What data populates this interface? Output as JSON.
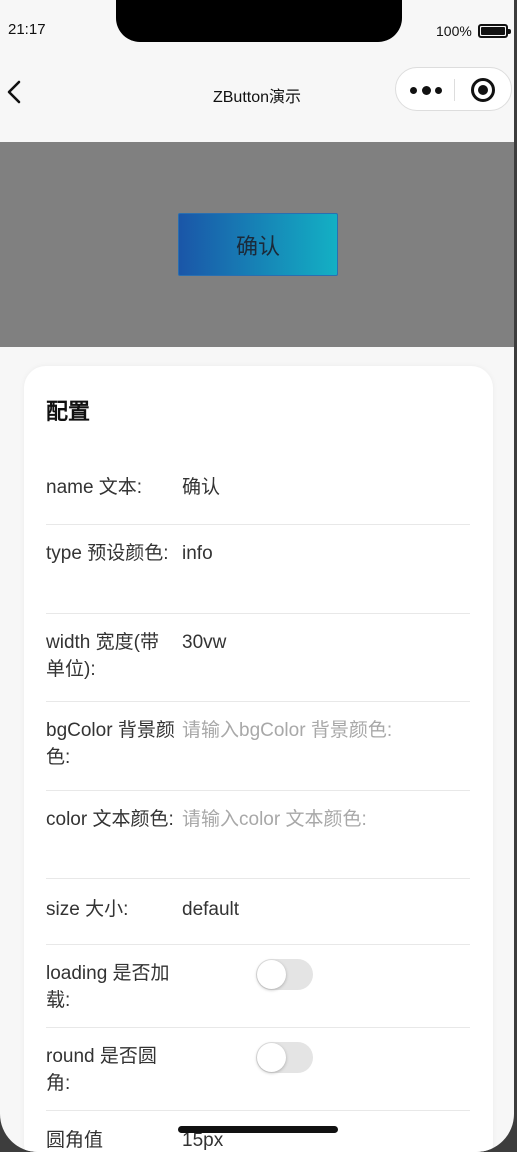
{
  "status_bar": {
    "time": "21:17",
    "battery": "100%"
  },
  "nav": {
    "title": "ZButton演示"
  },
  "preview": {
    "button_label": "确认",
    "gradient_from": "#1a56a8",
    "gradient_to": "#13b0c4",
    "background": "#808080"
  },
  "config": {
    "title": "配置",
    "rows": [
      {
        "label": "name 文本:",
        "value": "确认",
        "kind": "input"
      },
      {
        "label": "type 预设颜色:",
        "value": "info",
        "kind": "input"
      },
      {
        "label": "width 宽度(带单位):",
        "value": "30vw",
        "kind": "input"
      },
      {
        "label": "bgColor 背景颜色:",
        "placeholder": "请输入bgColor 背景颜色:",
        "kind": "input"
      },
      {
        "label": "color 文本颜色:",
        "placeholder": "请输入color 文本颜色:",
        "kind": "input"
      },
      {
        "label": "size 大小:",
        "value": "default",
        "kind": "select"
      },
      {
        "label": "loading 是否加载:",
        "checked": false,
        "kind": "toggle"
      },
      {
        "label": "round 是否圆角:",
        "checked": false,
        "kind": "toggle"
      },
      {
        "label": "圆角值",
        "value": "15px",
        "kind": "input"
      }
    ]
  }
}
